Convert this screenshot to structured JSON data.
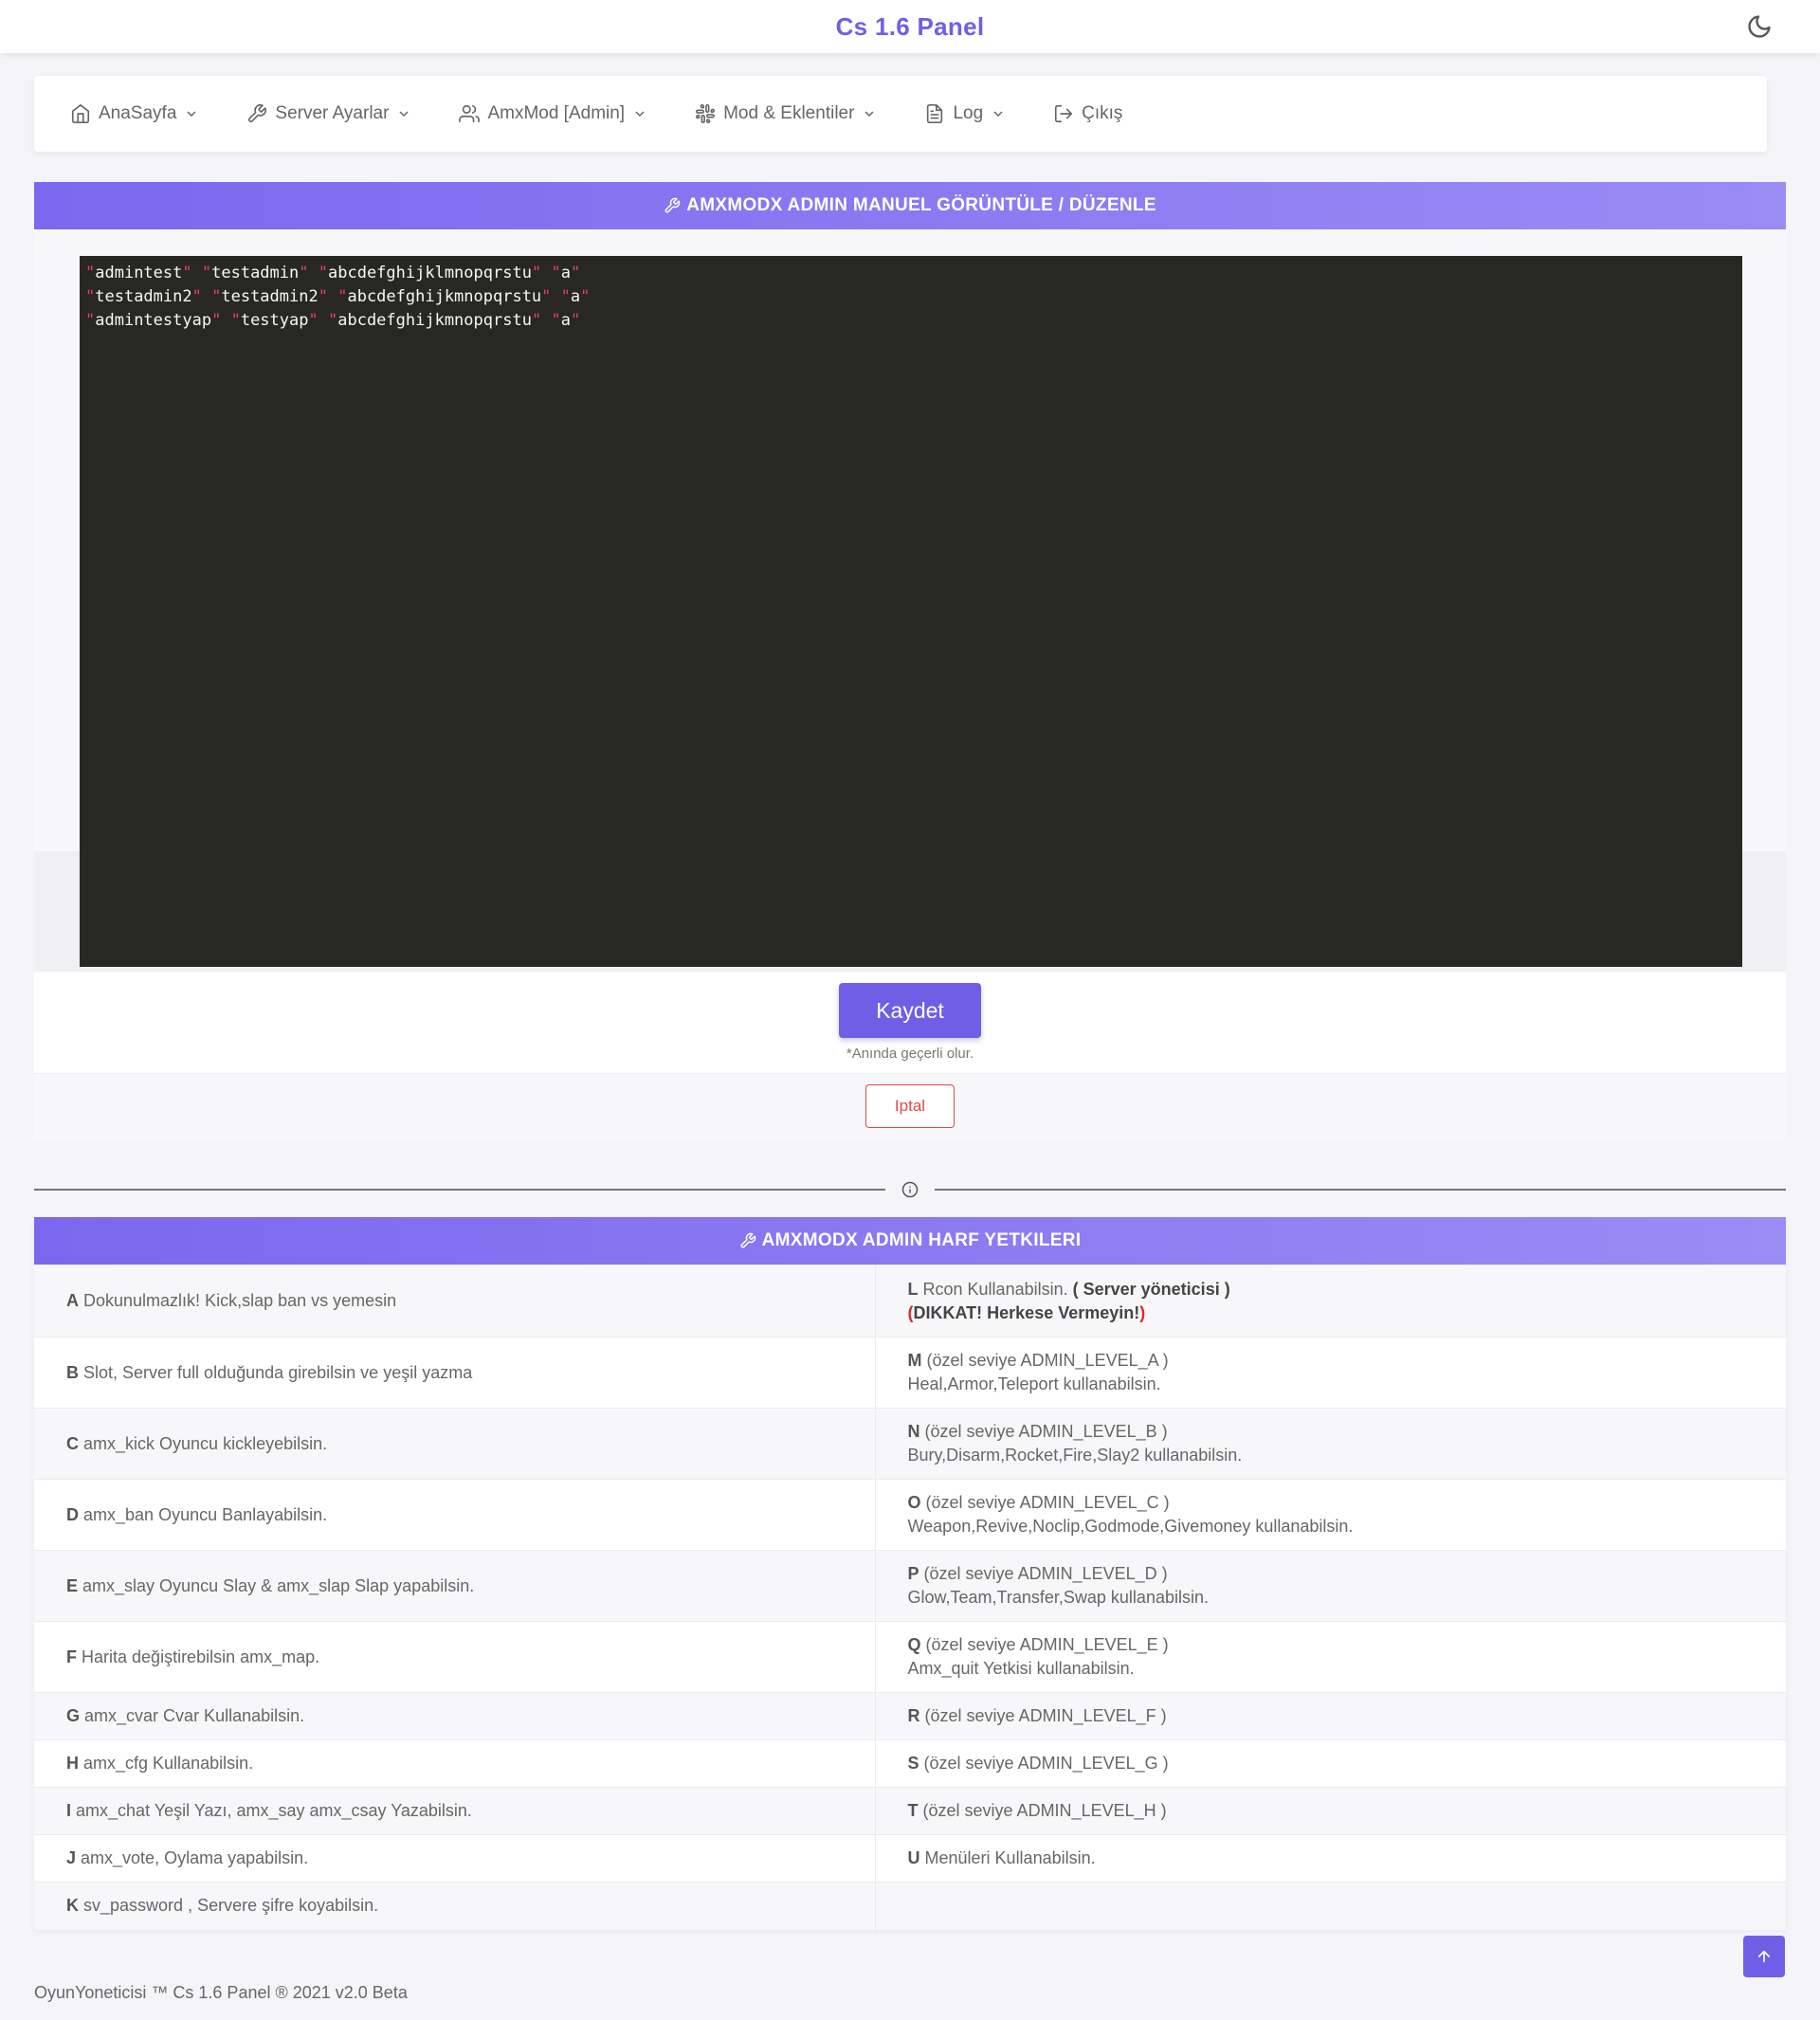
{
  "app": {
    "title": "Cs 1.6 Panel",
    "theme_icon": "moon-icon"
  },
  "nav": {
    "items": [
      {
        "label": "AnaSayfa",
        "icon": "home-icon"
      },
      {
        "label": "Server Ayarlar",
        "icon": "wrench-icon"
      },
      {
        "label": "AmxMod [Admin]",
        "icon": "users-icon"
      },
      {
        "label": "Mod & Eklentiler",
        "icon": "slack-icon"
      },
      {
        "label": "Log",
        "icon": "file-text-icon"
      },
      {
        "label": "Çıkış",
        "icon": "log-out-icon"
      }
    ]
  },
  "editor_card": {
    "header": "AMXMODX ADMIN MANUEL GÖRÜNTÜLE / DÜZENLE",
    "lines": [
      [
        "admintest",
        "testadmin",
        "abcdefghijklmnopqrstu",
        "a"
      ],
      [
        "testadmin2",
        "testadmin2",
        "abcdefghijkmnopqrstu",
        "a"
      ],
      [
        "admintestyap",
        "testyap",
        "abcdefghijkmnopqrstu",
        "a"
      ]
    ],
    "save_label": "Kaydet",
    "save_note": "*Anında geçerli olur.",
    "cancel_label": "Iptal"
  },
  "flags_card": {
    "header": "AMXMODX ADMIN HARF YETKILERI",
    "left": [
      {
        "letter": "A",
        "text": "Dokunulmazlık! Kick,slap ban vs yemesin"
      },
      {
        "letter": "B",
        "text": "Slot, Server full olduğunda girebilsin ve yeşil yazma"
      },
      {
        "letter": "C",
        "text": "amx_kick Oyuncu kickleyebilsin."
      },
      {
        "letter": "D",
        "text": "amx_ban Oyuncu Banlayabilsin."
      },
      {
        "letter": "E",
        "text": "amx_slay Oyuncu Slay & amx_slap Slap yapabilsin."
      },
      {
        "letter": "F",
        "text": "Harita değiştirebilsin amx_map."
      },
      {
        "letter": "G",
        "text": "amx_cvar Cvar Kullanabilsin."
      },
      {
        "letter": "H",
        "text": "amx_cfg Kullanabilsin."
      },
      {
        "letter": "I",
        "text": "amx_chat Yeşil Yazı, amx_say amx_csay Yazabilsin."
      },
      {
        "letter": "J",
        "text": "amx_vote, Oylama yapabilsin."
      },
      {
        "letter": "K",
        "text": "sv_password , Servere şifre koyabilsin."
      }
    ],
    "right": [
      {
        "letter": "L",
        "text": "Rcon Kullanabilsin.",
        "bold": "( Server yöneticisi )",
        "paren_open": "(",
        "warn": "DIKKAT! Herkese Vermeyin!",
        "paren_close": ")"
      },
      {
        "letter": "M",
        "text": "(özel seviye ADMIN_LEVEL_A )",
        "text2": "Heal,Armor,Teleport kullanabilsin."
      },
      {
        "letter": "N",
        "text": "(özel seviye ADMIN_LEVEL_B )",
        "text2": "Bury,Disarm,Rocket,Fire,Slay2 kullanabilsin."
      },
      {
        "letter": "O",
        "text": "(özel seviye ADMIN_LEVEL_C )",
        "text2": "Weapon,Revive,Noclip,Godmode,Givemoney kullanabilsin."
      },
      {
        "letter": "P",
        "text": "(özel seviye ADMIN_LEVEL_D )",
        "text2": "Glow,Team,Transfer,Swap kullanabilsin."
      },
      {
        "letter": "Q",
        "text": "(özel seviye ADMIN_LEVEL_E )",
        "text2": "Amx_quit Yetkisi kullanabilsin."
      },
      {
        "letter": "R",
        "text": "(özel seviye ADMIN_LEVEL_F )"
      },
      {
        "letter": "S",
        "text": "(özel seviye ADMIN_LEVEL_G )"
      },
      {
        "letter": "T",
        "text": "(özel seviye ADMIN_LEVEL_H )"
      },
      {
        "letter": "U",
        "text": "Menüleri Kullanabilsin."
      },
      {
        "letter": "",
        "text": ""
      }
    ]
  },
  "footer": {
    "text": "OyunYoneticisi ™ Cs 1.6 Panel ® 2021 v2.0 Beta"
  },
  "colors": {
    "accent": "#6f5fe6",
    "danger": "#e04848",
    "editor_bg": "#272822"
  }
}
